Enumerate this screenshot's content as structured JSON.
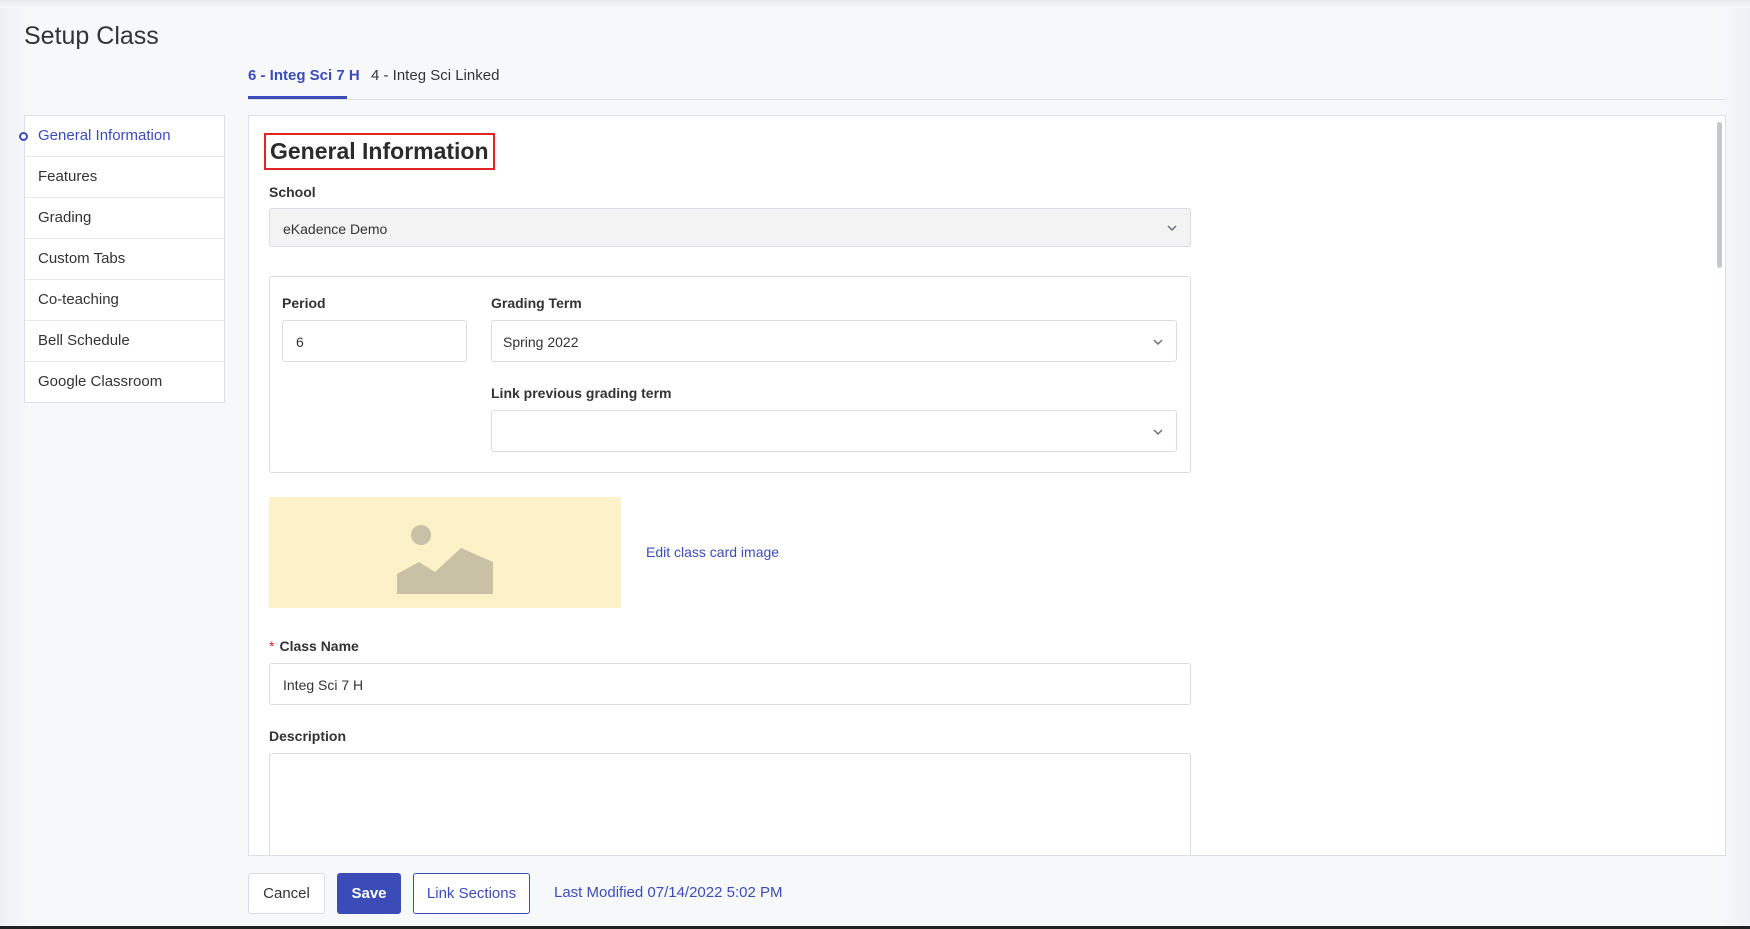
{
  "page": {
    "title": "Setup Class"
  },
  "tabs": [
    {
      "label": "6 - Integ Sci 7 H",
      "active": true
    },
    {
      "label": "4 - Integ Sci Linked",
      "active": false
    }
  ],
  "sidebar": {
    "items": [
      {
        "label": "General Information",
        "active": true
      },
      {
        "label": "Features"
      },
      {
        "label": "Grading"
      },
      {
        "label": "Custom Tabs"
      },
      {
        "label": "Co-teaching"
      },
      {
        "label": "Bell Schedule"
      },
      {
        "label": "Google Classroom"
      }
    ]
  },
  "form": {
    "section_title": "General Information",
    "school": {
      "label": "School",
      "value": "eKadence Demo"
    },
    "period": {
      "label": "Period",
      "value": "6"
    },
    "grading_term": {
      "label": "Grading Term",
      "value": "Spring 2022"
    },
    "link_previous": {
      "label": "Link previous grading term",
      "value": ""
    },
    "edit_image_link": "Edit class card image",
    "class_name": {
      "label": "Class Name",
      "required_mark": "*",
      "value": "Integ Sci 7 H"
    },
    "description": {
      "label": "Description",
      "value": ""
    }
  },
  "footer": {
    "cancel": "Cancel",
    "save": "Save",
    "link_sections": "Link Sections",
    "last_modified": "Last Modified 07/14/2022 5:02 PM"
  },
  "colors": {
    "accent": "#3b4cb8",
    "highlight_border": "#e02424",
    "image_placeholder_bg": "#fdf1c8",
    "image_placeholder_icon": "#c9c1a6"
  },
  "icons": [
    "chevron-down-icon",
    "image-placeholder-icon",
    "nav-active-dot-icon"
  ]
}
